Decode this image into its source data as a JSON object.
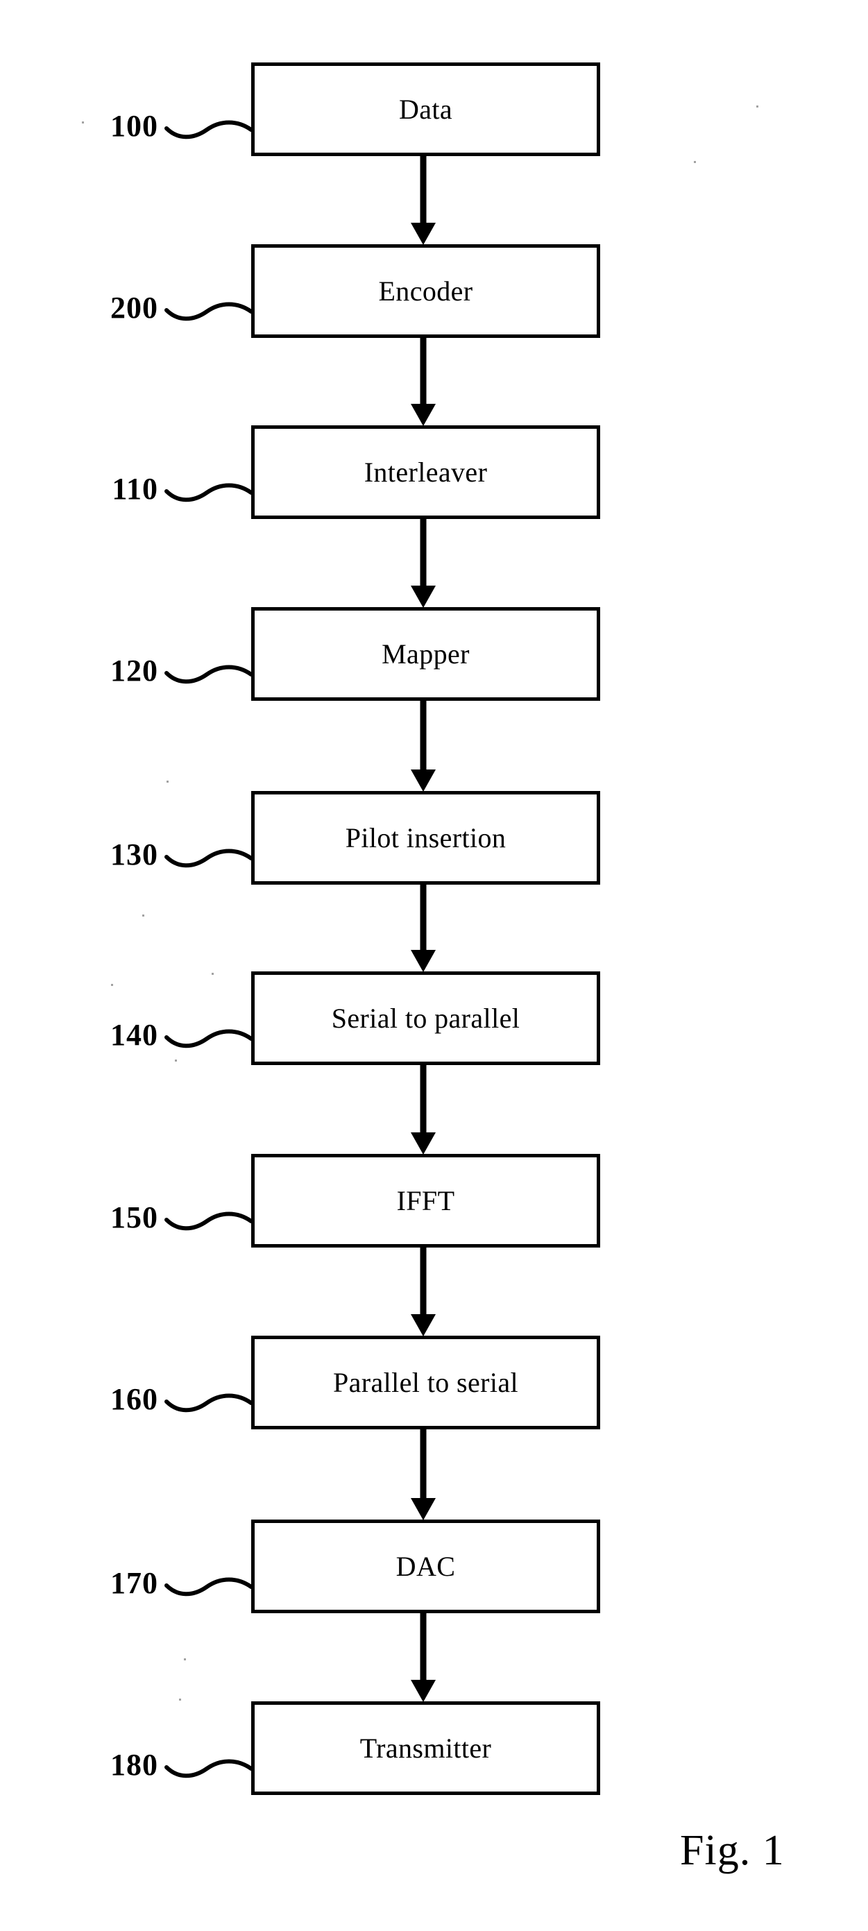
{
  "figure": {
    "caption": "Fig. 1",
    "type": "block-flow-diagram",
    "orientation": "vertical",
    "ink_color": "#000000",
    "background_color": "#ffffff"
  },
  "blocks": [
    {
      "ref": "100",
      "label": "Data"
    },
    {
      "ref": "200",
      "label": "Encoder"
    },
    {
      "ref": "110",
      "label": "Interleaver"
    },
    {
      "ref": "120",
      "label": "Mapper"
    },
    {
      "ref": "130",
      "label": "Pilot insertion"
    },
    {
      "ref": "140",
      "label": "Serial to parallel"
    },
    {
      "ref": "150",
      "label": "IFFT"
    },
    {
      "ref": "160",
      "label": "Parallel to serial"
    },
    {
      "ref": "170",
      "label": "DAC"
    },
    {
      "ref": "180",
      "label": "Transmitter"
    }
  ],
  "connectors": [
    {
      "from": "100",
      "to": "200"
    },
    {
      "from": "200",
      "to": "110"
    },
    {
      "from": "110",
      "to": "120"
    },
    {
      "from": "120",
      "to": "130"
    },
    {
      "from": "130",
      "to": "140"
    },
    {
      "from": "140",
      "to": "150"
    },
    {
      "from": "150",
      "to": "160"
    },
    {
      "from": "160",
      "to": "170"
    },
    {
      "from": "170",
      "to": "180"
    }
  ]
}
